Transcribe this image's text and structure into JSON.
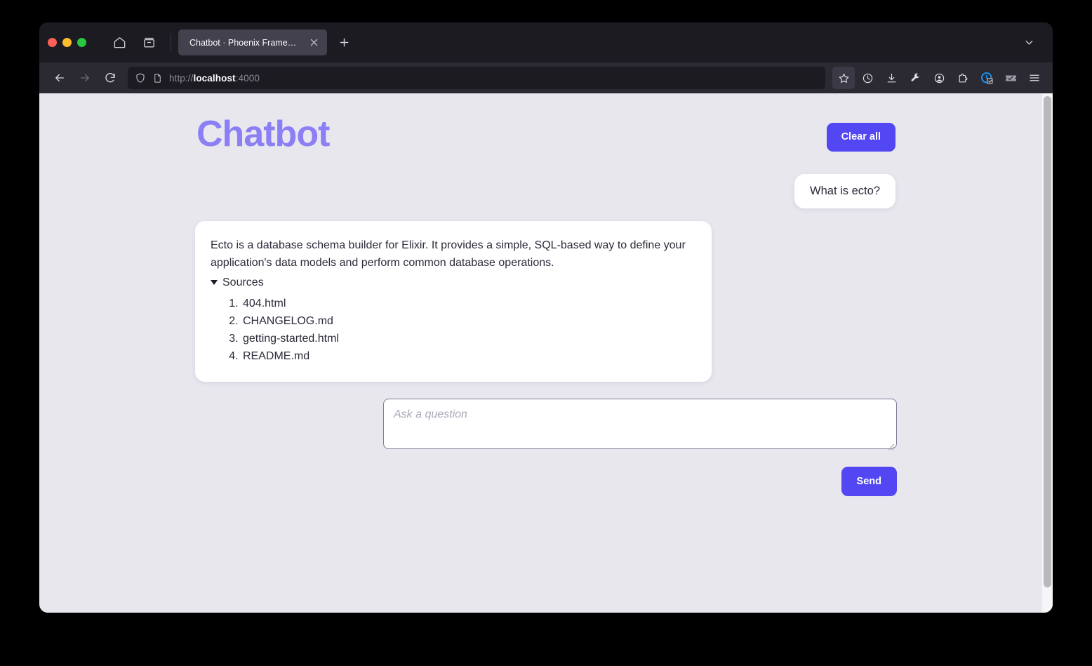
{
  "browser": {
    "window_controls": [
      "close",
      "minimize",
      "maximize"
    ],
    "nav_icons": {
      "home": "home-icon",
      "archive": "archive-box-icon",
      "back": "back-arrow-icon",
      "forward": "forward-arrow-icon",
      "reload": "reload-icon",
      "shield": "shield-icon",
      "page": "page-icon",
      "new_tab": "plus-icon",
      "tab_list": "chevron-down-icon"
    },
    "tab": {
      "title": "Chatbot · Phoenix Framework",
      "close_label": "×"
    },
    "new_tab_label": "+",
    "url": {
      "scheme": "http://",
      "host": "localhost",
      "port": ":4000",
      "full": "http://localhost:4000"
    },
    "toolbar_icons": [
      "bookmark-star-icon",
      "history-clock-icon",
      "downloads-icon",
      "wrench-icon",
      "account-icon",
      "extensions-puzzle-icon",
      "privacy-badger-icon",
      "ticket-icon",
      "app-menu-icon"
    ]
  },
  "page": {
    "title": "Chatbot",
    "clear_all_label": "Clear all",
    "messages": [
      {
        "role": "user",
        "text": "What is ecto?"
      },
      {
        "role": "bot",
        "text": "Ecto is a database schema builder for Elixir. It provides a simple, SQL-based way to define your application's data models and perform common database operations.",
        "sources_label": "Sources",
        "sources": [
          "404.html",
          "CHANGELOG.md",
          "getting-started.html",
          "README.md"
        ]
      }
    ],
    "composer": {
      "placeholder": "Ask a question",
      "value": "",
      "send_label": "Send"
    }
  },
  "colors": {
    "accent": "#5347f4",
    "title_purple": "#8b7ff5",
    "page_bg": "#e8e7ee",
    "bubble_bg": "#ffffff",
    "chrome_tabstrip": "#1c1b22",
    "chrome_navbar": "#2b2a33"
  }
}
